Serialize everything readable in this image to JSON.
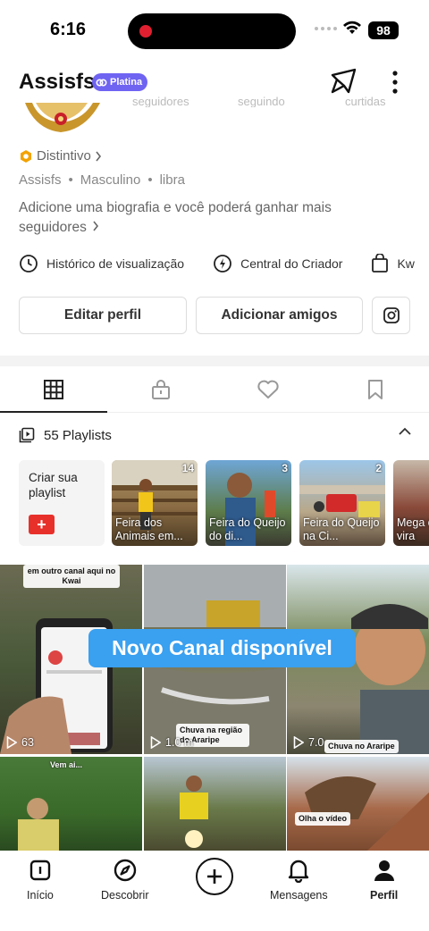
{
  "status_bar": {
    "time": "6:16",
    "battery": "98"
  },
  "header": {
    "username": "Assisfs",
    "tier_badge": "Platina"
  },
  "profile": {
    "stats_partial": [
      "seguidores",
      "seguindo",
      "curtidas"
    ],
    "badge_link": "Distintivo",
    "meta": [
      "Assisfs",
      "Masculino",
      "libra"
    ],
    "bio_placeholder": "Adicione uma biografia e você poderá ganhar mais seguidores",
    "quick_links": [
      "Histórico de visualização",
      "Central do Criador",
      "Kw"
    ],
    "edit_button": "Editar perfil",
    "add_friends_button": "Adicionar amigos"
  },
  "tabs": [
    {
      "icon": "grid-icon",
      "active": true
    },
    {
      "icon": "lock-icon",
      "active": false
    },
    {
      "icon": "heart-icon",
      "active": false
    },
    {
      "icon": "bookmark-icon",
      "active": false
    }
  ],
  "playlists": {
    "label": "55 Playlists",
    "create_label": "Criar sua playlist",
    "items": [
      {
        "count": "14",
        "title": "Feira dos Animais em..."
      },
      {
        "count": "3",
        "title": "Feira do Queijo do di..."
      },
      {
        "count": "2",
        "title": "Feira do Queijo na Ci..."
      },
      {
        "count": "",
        "title": "Mega da vira"
      }
    ]
  },
  "banner": "Novo Canal  disponível",
  "videos": [
    {
      "plays": "63",
      "caption": "em outro canal aqui no Kwai"
    },
    {
      "plays": "1.0 m",
      "caption": "Chuva na região do Araripe"
    },
    {
      "plays": "7.0",
      "caption": "Chuva no Araripe"
    },
    {
      "plays": "",
      "caption": "Vem ai..."
    },
    {
      "plays": "",
      "caption": ""
    },
    {
      "plays": "",
      "caption": "Olha o vídeo"
    }
  ],
  "bottom_nav": [
    {
      "label": "Início",
      "icon": "home-icon",
      "active": false
    },
    {
      "label": "Descobrir",
      "icon": "compass-icon",
      "active": false
    },
    {
      "label": "Mensagens",
      "icon": "bell-icon",
      "active": false
    },
    {
      "label": "Perfil",
      "icon": "person-icon",
      "active": true
    }
  ],
  "colors": {
    "accent_red": "#e8302a",
    "platina_purple": "#6f63f2",
    "banner_blue": "#3aa0f0"
  }
}
